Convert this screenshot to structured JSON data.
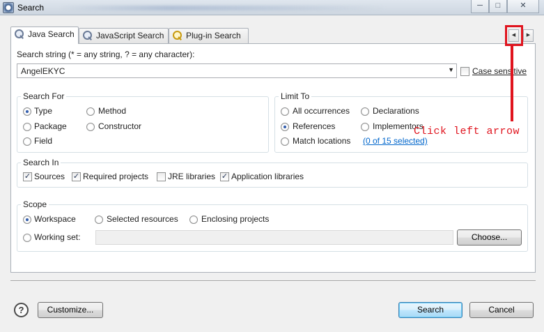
{
  "window": {
    "title": "Search",
    "controls": [
      "minimize",
      "maximize",
      "close"
    ]
  },
  "tabs": [
    {
      "label": "Java Search",
      "active": true
    },
    {
      "label": "JavaScript Search",
      "active": false
    },
    {
      "label": "Plug-in Search",
      "active": false
    }
  ],
  "search": {
    "string_label": "Search string (* = any string, ? = any character):",
    "value": "AngelEKYC",
    "case_sensitive_label": "Case sensitive",
    "case_sensitive": false
  },
  "search_for": {
    "title": "Search For",
    "options": [
      {
        "label": "Type",
        "selected": true
      },
      {
        "label": "Method",
        "selected": false
      },
      {
        "label": "Package",
        "selected": false
      },
      {
        "label": "Constructor",
        "selected": false
      },
      {
        "label": "Field",
        "selected": false
      }
    ]
  },
  "limit_to": {
    "title": "Limit To",
    "options": [
      {
        "label": "All occurrences",
        "selected": false
      },
      {
        "label": "Declarations",
        "selected": false
      },
      {
        "label": "References",
        "selected": true
      },
      {
        "label": "Implementors",
        "selected": false
      },
      {
        "label": "Match locations",
        "selected": false
      }
    ],
    "match_link": "(0 of 15 selected)"
  },
  "search_in": {
    "title": "Search In",
    "options": [
      {
        "label": "Sources",
        "checked": true
      },
      {
        "label": "Required projects",
        "checked": true
      },
      {
        "label": "JRE libraries",
        "checked": false
      },
      {
        "label": "Application libraries",
        "checked": true
      }
    ]
  },
  "scope": {
    "title": "Scope",
    "options": [
      {
        "label": "Workspace",
        "selected": true
      },
      {
        "label": "Selected resources",
        "selected": false
      },
      {
        "label": "Enclosing projects",
        "selected": false
      },
      {
        "label": "Working set:",
        "selected": false
      }
    ],
    "working_set_value": "",
    "choose_label": "Choose..."
  },
  "footer": {
    "help": "?",
    "customize_label": "Customize...",
    "search_label": "Search",
    "cancel_label": "Cancel"
  },
  "annotation": {
    "text": "Click left arrow",
    "color": "#e0141e"
  },
  "colors": {
    "link": "#0066cc",
    "dialog_bg": "#f0f0f0"
  }
}
